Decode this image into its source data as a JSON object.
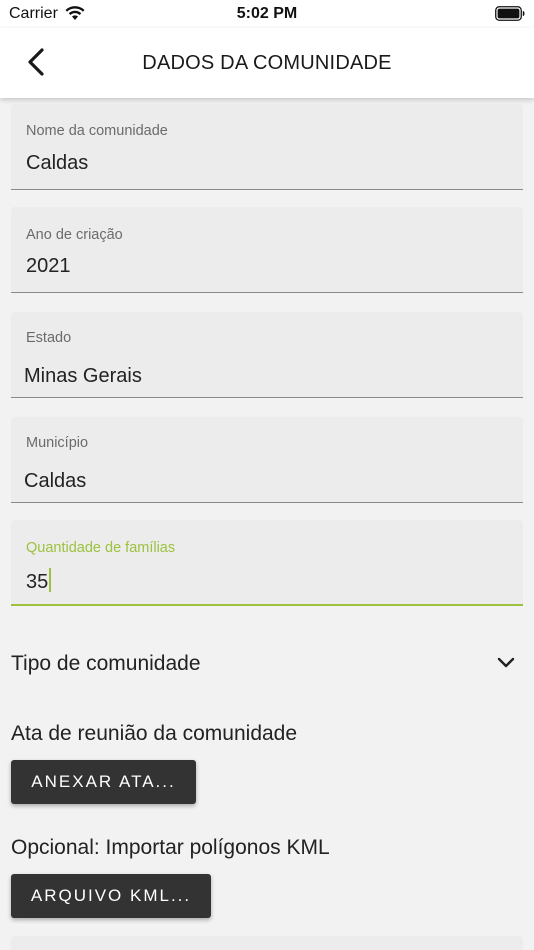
{
  "status_bar": {
    "carrier": "Carrier",
    "time": "5:02 PM"
  },
  "header": {
    "title": "DADOS DA COMUNIDADE"
  },
  "fields": [
    {
      "label": "Nome da comunidade",
      "value": "Caldas"
    },
    {
      "label": "Ano de criação",
      "value": "2021"
    },
    {
      "label": "Estado",
      "value": "Minas Gerais"
    },
    {
      "label": "Município",
      "value": "Caldas"
    },
    {
      "label": "Quantidade de famílias",
      "value": "35"
    }
  ],
  "dropdown": {
    "label": "Tipo de comunidade"
  },
  "sections": {
    "ata_label": "Ata de reunião da comunidade",
    "ata_button": "ANEXAR ATA...",
    "kml_label": "Opcional: Importar polígonos KML",
    "kml_button": "ARQUIVO KML..."
  },
  "colors": {
    "accent": "#9cc23f",
    "button_bg": "#333333",
    "background": "#f2f2f2"
  }
}
